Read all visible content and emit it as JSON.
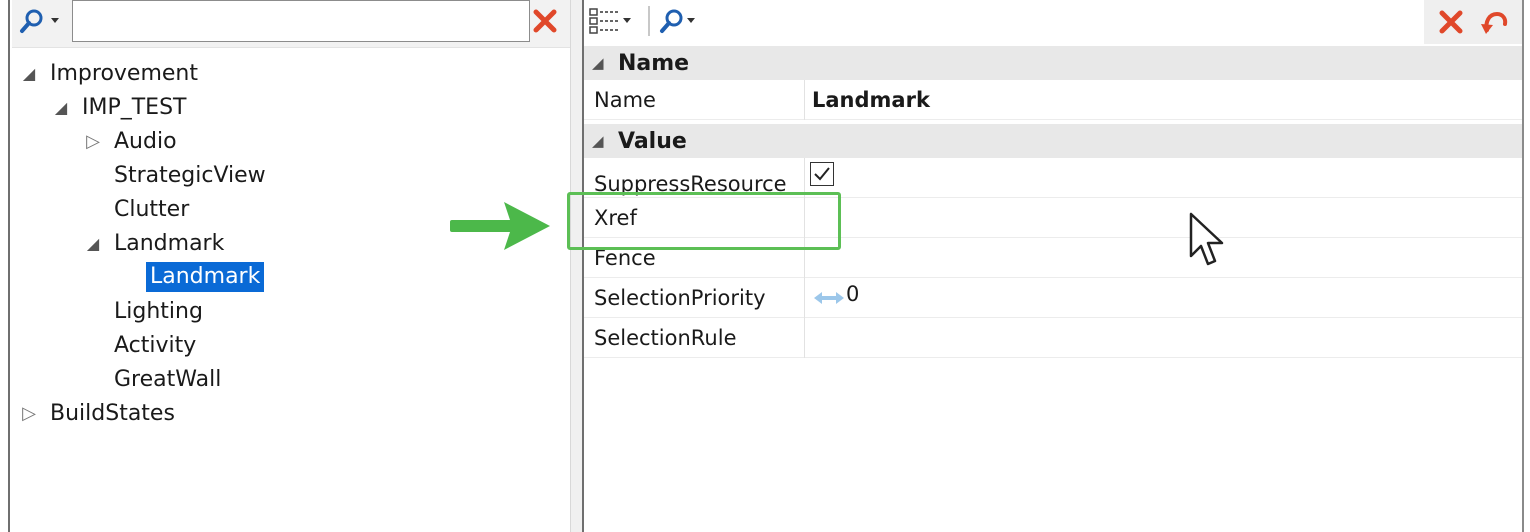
{
  "left_panel": {
    "search": {
      "placeholder": "",
      "value": ""
    },
    "tree": [
      {
        "label": "Improvement",
        "level": 0,
        "toggle": "expanded"
      },
      {
        "label": "IMP_TEST",
        "level": 1,
        "toggle": "expanded"
      },
      {
        "label": "Audio",
        "level": 2,
        "toggle": "collapsed"
      },
      {
        "label": "StrategicView",
        "level": 2,
        "toggle": "none"
      },
      {
        "label": "Clutter",
        "level": 2,
        "toggle": "none"
      },
      {
        "label": "Landmark",
        "level": 2,
        "toggle": "expanded"
      },
      {
        "label": "Landmark",
        "level": 3,
        "toggle": "none",
        "selected": true
      },
      {
        "label": "Lighting",
        "level": 2,
        "toggle": "none"
      },
      {
        "label": "Activity",
        "level": 2,
        "toggle": "none"
      },
      {
        "label": "GreatWall",
        "level": 2,
        "toggle": "none"
      },
      {
        "label": "BuildStates",
        "level": 0,
        "toggle": "collapsed"
      }
    ]
  },
  "property_grid": {
    "categories": [
      {
        "name": "Name",
        "rows": [
          {
            "name": "Name",
            "value": "Landmark"
          }
        ]
      },
      {
        "name": "Value",
        "rows": [
          {
            "name": "SuppressResource",
            "value": "",
            "checked": true
          },
          {
            "name": "Xref",
            "value": ""
          },
          {
            "name": "Fence",
            "value": ""
          },
          {
            "name": "SelectionPriority",
            "value": "0"
          },
          {
            "name": "SelectionRule",
            "value": ""
          }
        ]
      }
    ]
  },
  "colors": {
    "selection": "#0a6ad6",
    "delete_red": "#e0482a",
    "highlight_green": "#5cbf55",
    "category_bg": "#e8e8e8"
  },
  "icons": {
    "left_search": "search-dropdown-icon",
    "left_clear": "red-x-icon",
    "right_view": "property-list-view-icon",
    "right_search": "search-dropdown-icon",
    "right_clear": "red-x-icon",
    "right_undo": "undo-icon",
    "priority": "double-arrow-icon"
  }
}
